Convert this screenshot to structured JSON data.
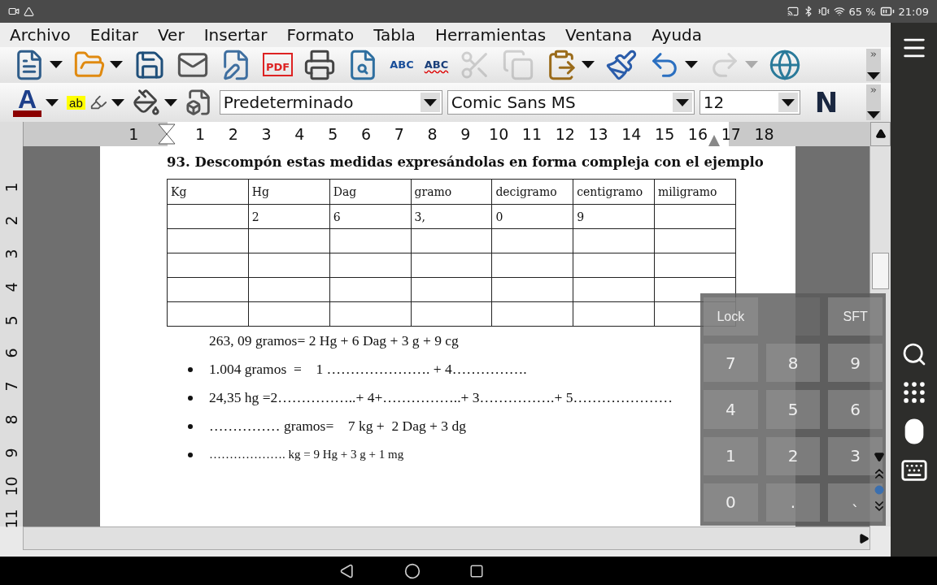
{
  "status_bar": {
    "battery": "65 %",
    "time": "21:09"
  },
  "menu": [
    "Archivo",
    "Editar",
    "Ver",
    "Insertar",
    "Formato",
    "Tabla",
    "Herramientas",
    "Ventana",
    "Ayuda"
  ],
  "toolbar_standard": [
    {
      "kind": "new",
      "dropdown": true,
      "disabled": false
    },
    {
      "kind": "open",
      "dropdown": true,
      "disabled": false
    },
    {
      "kind": "save",
      "dropdown": false,
      "disabled": false
    },
    {
      "kind": "mail",
      "dropdown": false,
      "disabled": false
    },
    {
      "kind": "edit",
      "dropdown": false,
      "disabled": false
    },
    {
      "kind": "pdf",
      "text": "PDF",
      "dropdown": false,
      "disabled": false
    },
    {
      "kind": "print",
      "dropdown": false,
      "disabled": false
    },
    {
      "kind": "preview",
      "dropdown": false,
      "disabled": false
    },
    {
      "kind": "spell",
      "text": "ABC",
      "dropdown": false,
      "disabled": false
    },
    {
      "kind": "autospell",
      "text": "ABC",
      "dropdown": false,
      "disabled": false
    },
    {
      "kind": "cut",
      "dropdown": false,
      "disabled": true
    },
    {
      "kind": "copy",
      "dropdown": false,
      "disabled": true
    },
    {
      "kind": "paste",
      "dropdown": true,
      "disabled": false
    },
    {
      "kind": "brush",
      "dropdown": false,
      "disabled": false
    },
    {
      "kind": "undo",
      "dropdown": true,
      "disabled": false
    },
    {
      "kind": "redo",
      "dropdown": true,
      "disabled": true
    },
    {
      "kind": "globe",
      "dropdown": false,
      "disabled": false
    }
  ],
  "toolbar_format": {
    "font_color_glyph": "A",
    "highlight_glyph": "ab",
    "paragraph_style": "Predeterminado",
    "font_name": "Comic Sans MS",
    "font_size": "12",
    "bold_glyph": "N"
  },
  "ruler": [
    "1",
    "1",
    "2",
    "3",
    "4",
    "5",
    "6",
    "7",
    "8",
    "9",
    "10",
    "11",
    "12",
    "13",
    "14",
    "15",
    "16",
    "17",
    "18"
  ],
  "vertical_ruler": [
    "1",
    "2",
    "3",
    "4",
    "5",
    "6",
    "7",
    "8",
    "9",
    "10",
    "11"
  ],
  "document": {
    "heading": "93. Descompón estas medidas expresándolas en forma compleja con el ejemplo",
    "table": {
      "columns": [
        "Kg",
        "Hg",
        "Dag",
        "gramo",
        "decigramo",
        "centigramo",
        "miligramo"
      ],
      "rows": [
        [
          null,
          "2",
          "6",
          "3,",
          "0",
          "9",
          null
        ],
        [
          null,
          null,
          null,
          null,
          null,
          null,
          null
        ],
        [
          null,
          null,
          null,
          null,
          null,
          null,
          null
        ],
        [
          null,
          null,
          null,
          null,
          null,
          null,
          null
        ],
        [
          null,
          null,
          null,
          null,
          null,
          null,
          null
        ]
      ]
    },
    "lines": [
      {
        "text": "263, 09 gramos= 2 Hg + 6 Dag + 3 g + 9 cg",
        "bullet": false
      },
      {
        "text": "1.004 gramos  =    1 …………………. + 4…………….",
        "bullet": true
      },
      {
        "text": "24,35 hg =2……………..+ 4+……………..+ 3…………….+ 5…………………",
        "bullet": true
      },
      {
        "text": "…………… gramos=    7 kg +  2 Dag + 3 dg",
        "bullet": true
      },
      {
        "text": "………………. kg = 9 Hg + 3 g + 1 mg",
        "bullet": true
      }
    ]
  },
  "keypad": [
    {
      "kind": "key",
      "label": "Lock"
    },
    {
      "kind": "blank"
    },
    {
      "kind": "key",
      "label": "SFT"
    },
    {
      "kind": "key",
      "label": "7"
    },
    {
      "kind": "key",
      "label": "8"
    },
    {
      "kind": "key",
      "label": "9"
    },
    {
      "kind": "key",
      "label": "4"
    },
    {
      "kind": "key",
      "label": "5"
    },
    {
      "kind": "key",
      "label": "6"
    },
    {
      "kind": "key",
      "label": "1"
    },
    {
      "kind": "key",
      "label": "2"
    },
    {
      "kind": "key",
      "label": "3"
    },
    {
      "kind": "key",
      "label": "0"
    },
    {
      "kind": "key",
      "label": "."
    },
    {
      "kind": "key",
      "label": "`"
    }
  ]
}
